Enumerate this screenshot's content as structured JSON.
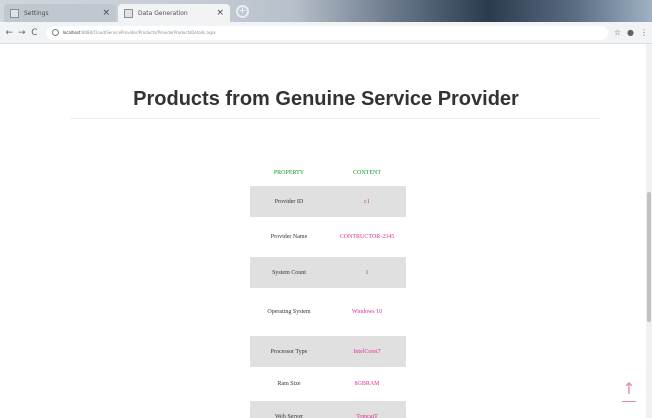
{
  "browser": {
    "tabs": [
      {
        "title": "Settings",
        "close": "×"
      },
      {
        "title": "Data Generation",
        "close": "×"
      }
    ],
    "new_tab_symbol": "+",
    "nav": {
      "back": "←",
      "forward": "→",
      "reload": "C",
      "menu": "⋮"
    },
    "address": {
      "host": "localhost",
      "path": ":8080/Cloud/ServiceProvider/Products/ProviderProductsDetails.aspx"
    },
    "icons": {
      "star": "☆",
      "profile": "●"
    }
  },
  "page": {
    "title": "Products from Genuine Service Provider",
    "table": {
      "headers": {
        "property": "PROPERTY",
        "content": "CONTENT"
      },
      "rows": [
        {
          "property": "Provider ID",
          "value": "c1",
          "shaded": true
        },
        {
          "property": "Provider Name",
          "value": "CONTRUCTOR-2345",
          "shaded": false
        },
        {
          "property": "System Count",
          "value": "1",
          "shaded": true
        },
        {
          "property": "Operating System",
          "value": "Windows 10",
          "shaded": false
        },
        {
          "property": "Processor Type",
          "value": "IntelCorei7",
          "shaded": true
        },
        {
          "property": "Ram Size",
          "value": "8GBRAM",
          "shaded": false
        },
        {
          "property": "Web Server",
          "value": "TomcatT",
          "shaded": true
        }
      ]
    },
    "back_to_top": "↑"
  },
  "colors": {
    "header_green": "#1a9a2a",
    "value_pink": "#d6338f",
    "row_shade": "#e0e0e0"
  }
}
